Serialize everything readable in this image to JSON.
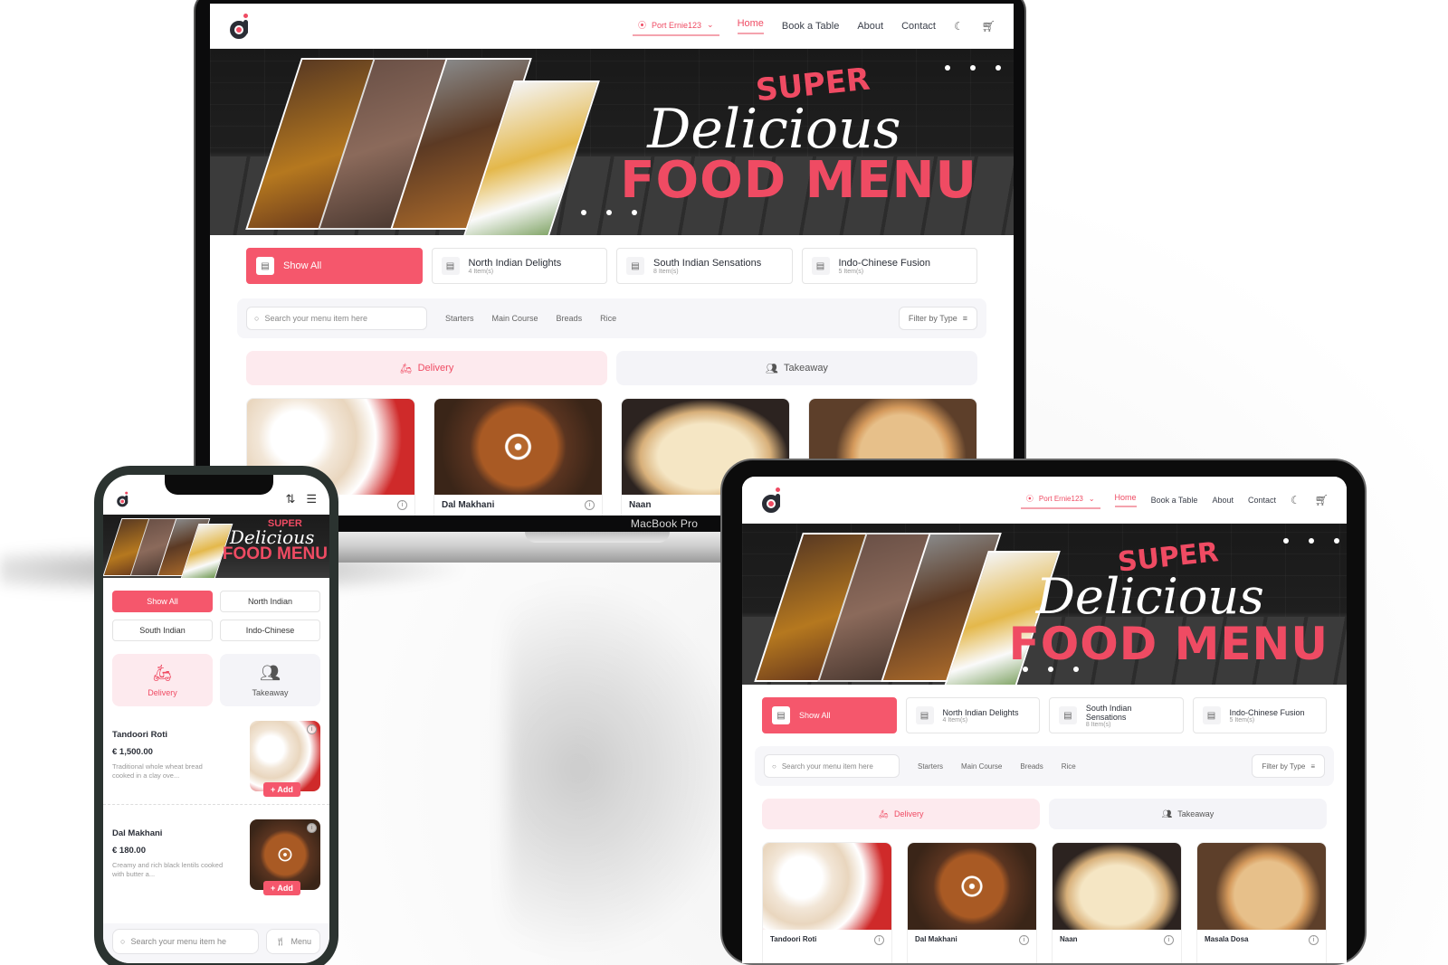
{
  "brand": {
    "accent": "#f5576c",
    "dark": "#2a2d35"
  },
  "header": {
    "location": "Port Ernie123",
    "nav": [
      "Home",
      "Book a Table",
      "About",
      "Contact"
    ],
    "active_nav": "Home",
    "icons": [
      "moon-icon",
      "cart-icon"
    ]
  },
  "banner": {
    "line1": "SUPER",
    "line2": "Delicious",
    "line3": "FOOD MENU"
  },
  "categories": [
    {
      "name": "Show All",
      "count": ""
    },
    {
      "name": "North Indian Delights",
      "count": "4 Item(s)"
    },
    {
      "name": "South Indian Sensations",
      "count": "8 Item(s)"
    },
    {
      "name": "Indo-Chinese Fusion",
      "count": "5 Item(s)"
    }
  ],
  "search": {
    "placeholder": "Search your menu item here"
  },
  "filter_tabs": [
    "Starters",
    "Main Course",
    "Breads",
    "Rice"
  ],
  "filter_button": "Filter by Type",
  "modes": {
    "delivery": "Delivery",
    "takeaway": "Takeaway"
  },
  "cards": [
    "Tandoori Roti",
    "Dal Makhani",
    "Naan",
    "Masala Dosa"
  ],
  "device_label": "MacBook Pro",
  "mobile": {
    "categories": [
      "Show All",
      "North Indian",
      "South Indian",
      "Indo-Chinese"
    ],
    "items": [
      {
        "name": "Tandoori Roti",
        "price": "€ 1,500.00",
        "desc": "Traditional whole wheat bread cooked in a clay ove...",
        "add": "+ Add"
      },
      {
        "name": "Dal Makhani",
        "price": "€ 180.00",
        "desc": "Creamy and rich black lentils cooked with butter a...",
        "add": "+ Add"
      }
    ],
    "search_placeholder": "Search your menu item he",
    "menu_button": "Menu"
  }
}
